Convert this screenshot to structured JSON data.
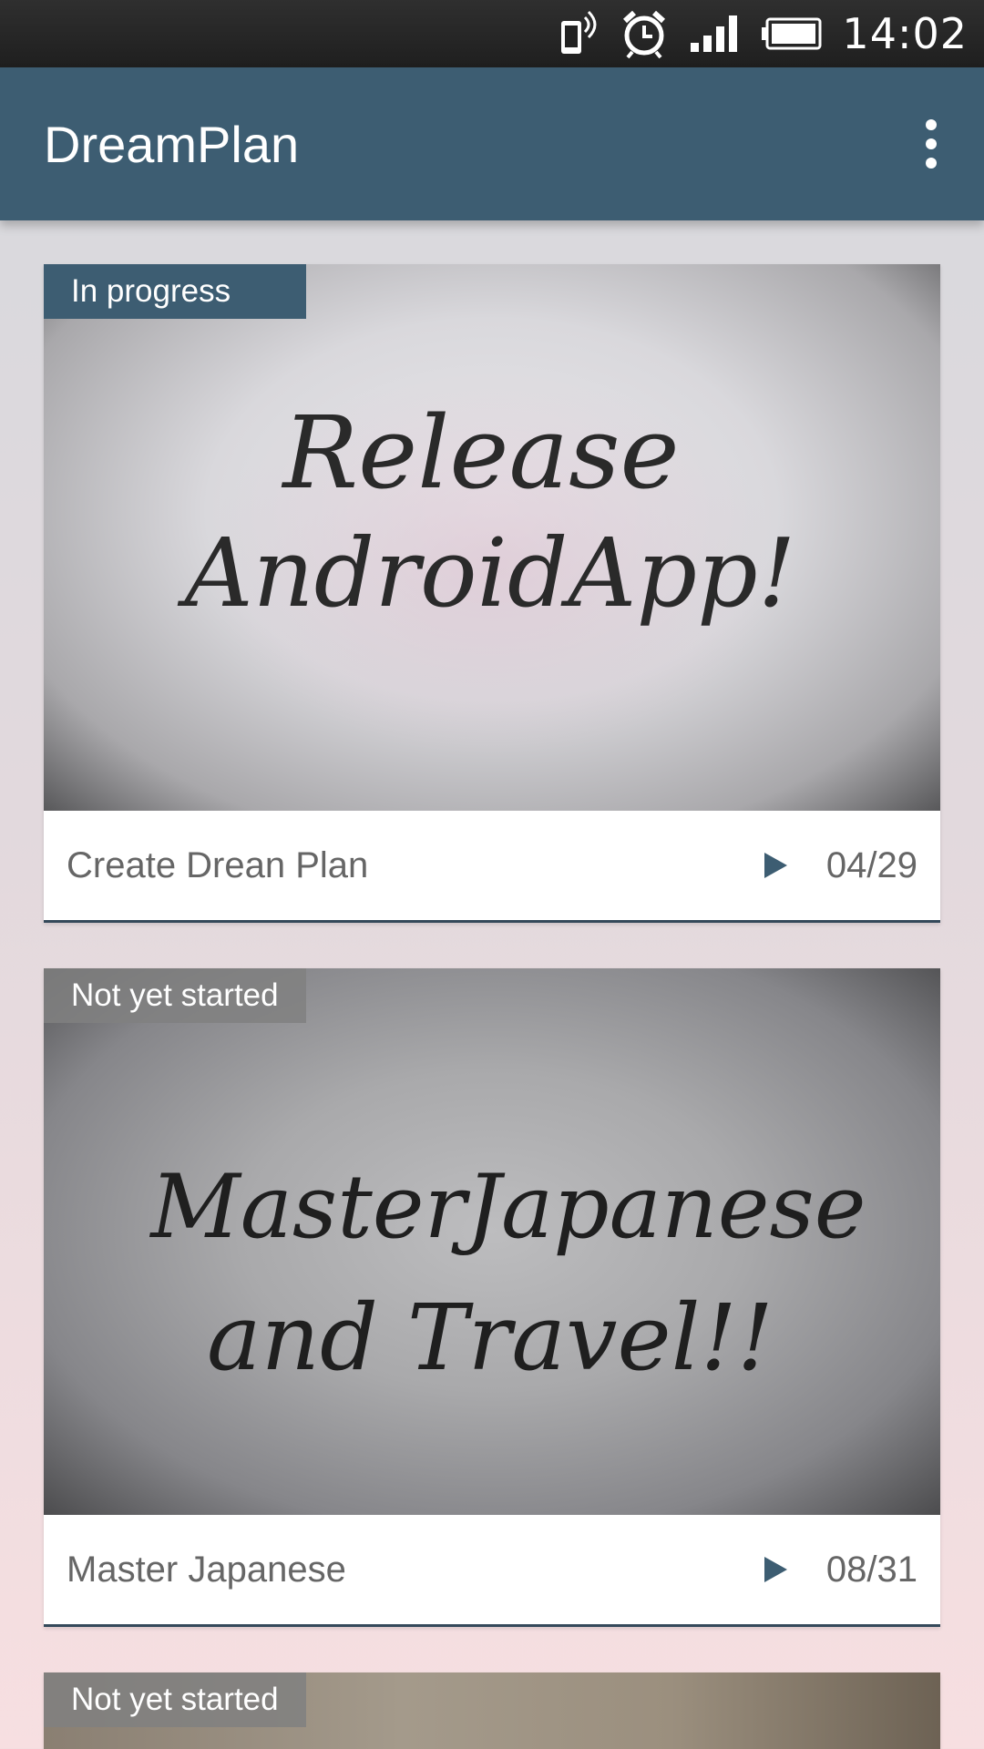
{
  "status_bar": {
    "time": "14:02",
    "icons": [
      "vibrate-icon",
      "alarm-icon",
      "signal-icon",
      "battery-icon"
    ]
  },
  "app_bar": {
    "title": "DreamPlan",
    "menu_icon": "overflow-menu-icon"
  },
  "colors": {
    "primary": "#3d5d72",
    "status_in_progress": "#3d5d72",
    "status_not_started": "#808080"
  },
  "plans": [
    {
      "status": "In progress",
      "photo_text_line1": "Release",
      "photo_text_line2": "AndroidApp!",
      "title": "Create Drean Plan",
      "date": "04/29"
    },
    {
      "status": "Not yet started",
      "photo_text_line1": "MasterJapanese",
      "photo_text_line2": "and  Travel!!",
      "title": "Master Japanese",
      "date": "08/31"
    },
    {
      "status": "Not yet started"
    }
  ]
}
